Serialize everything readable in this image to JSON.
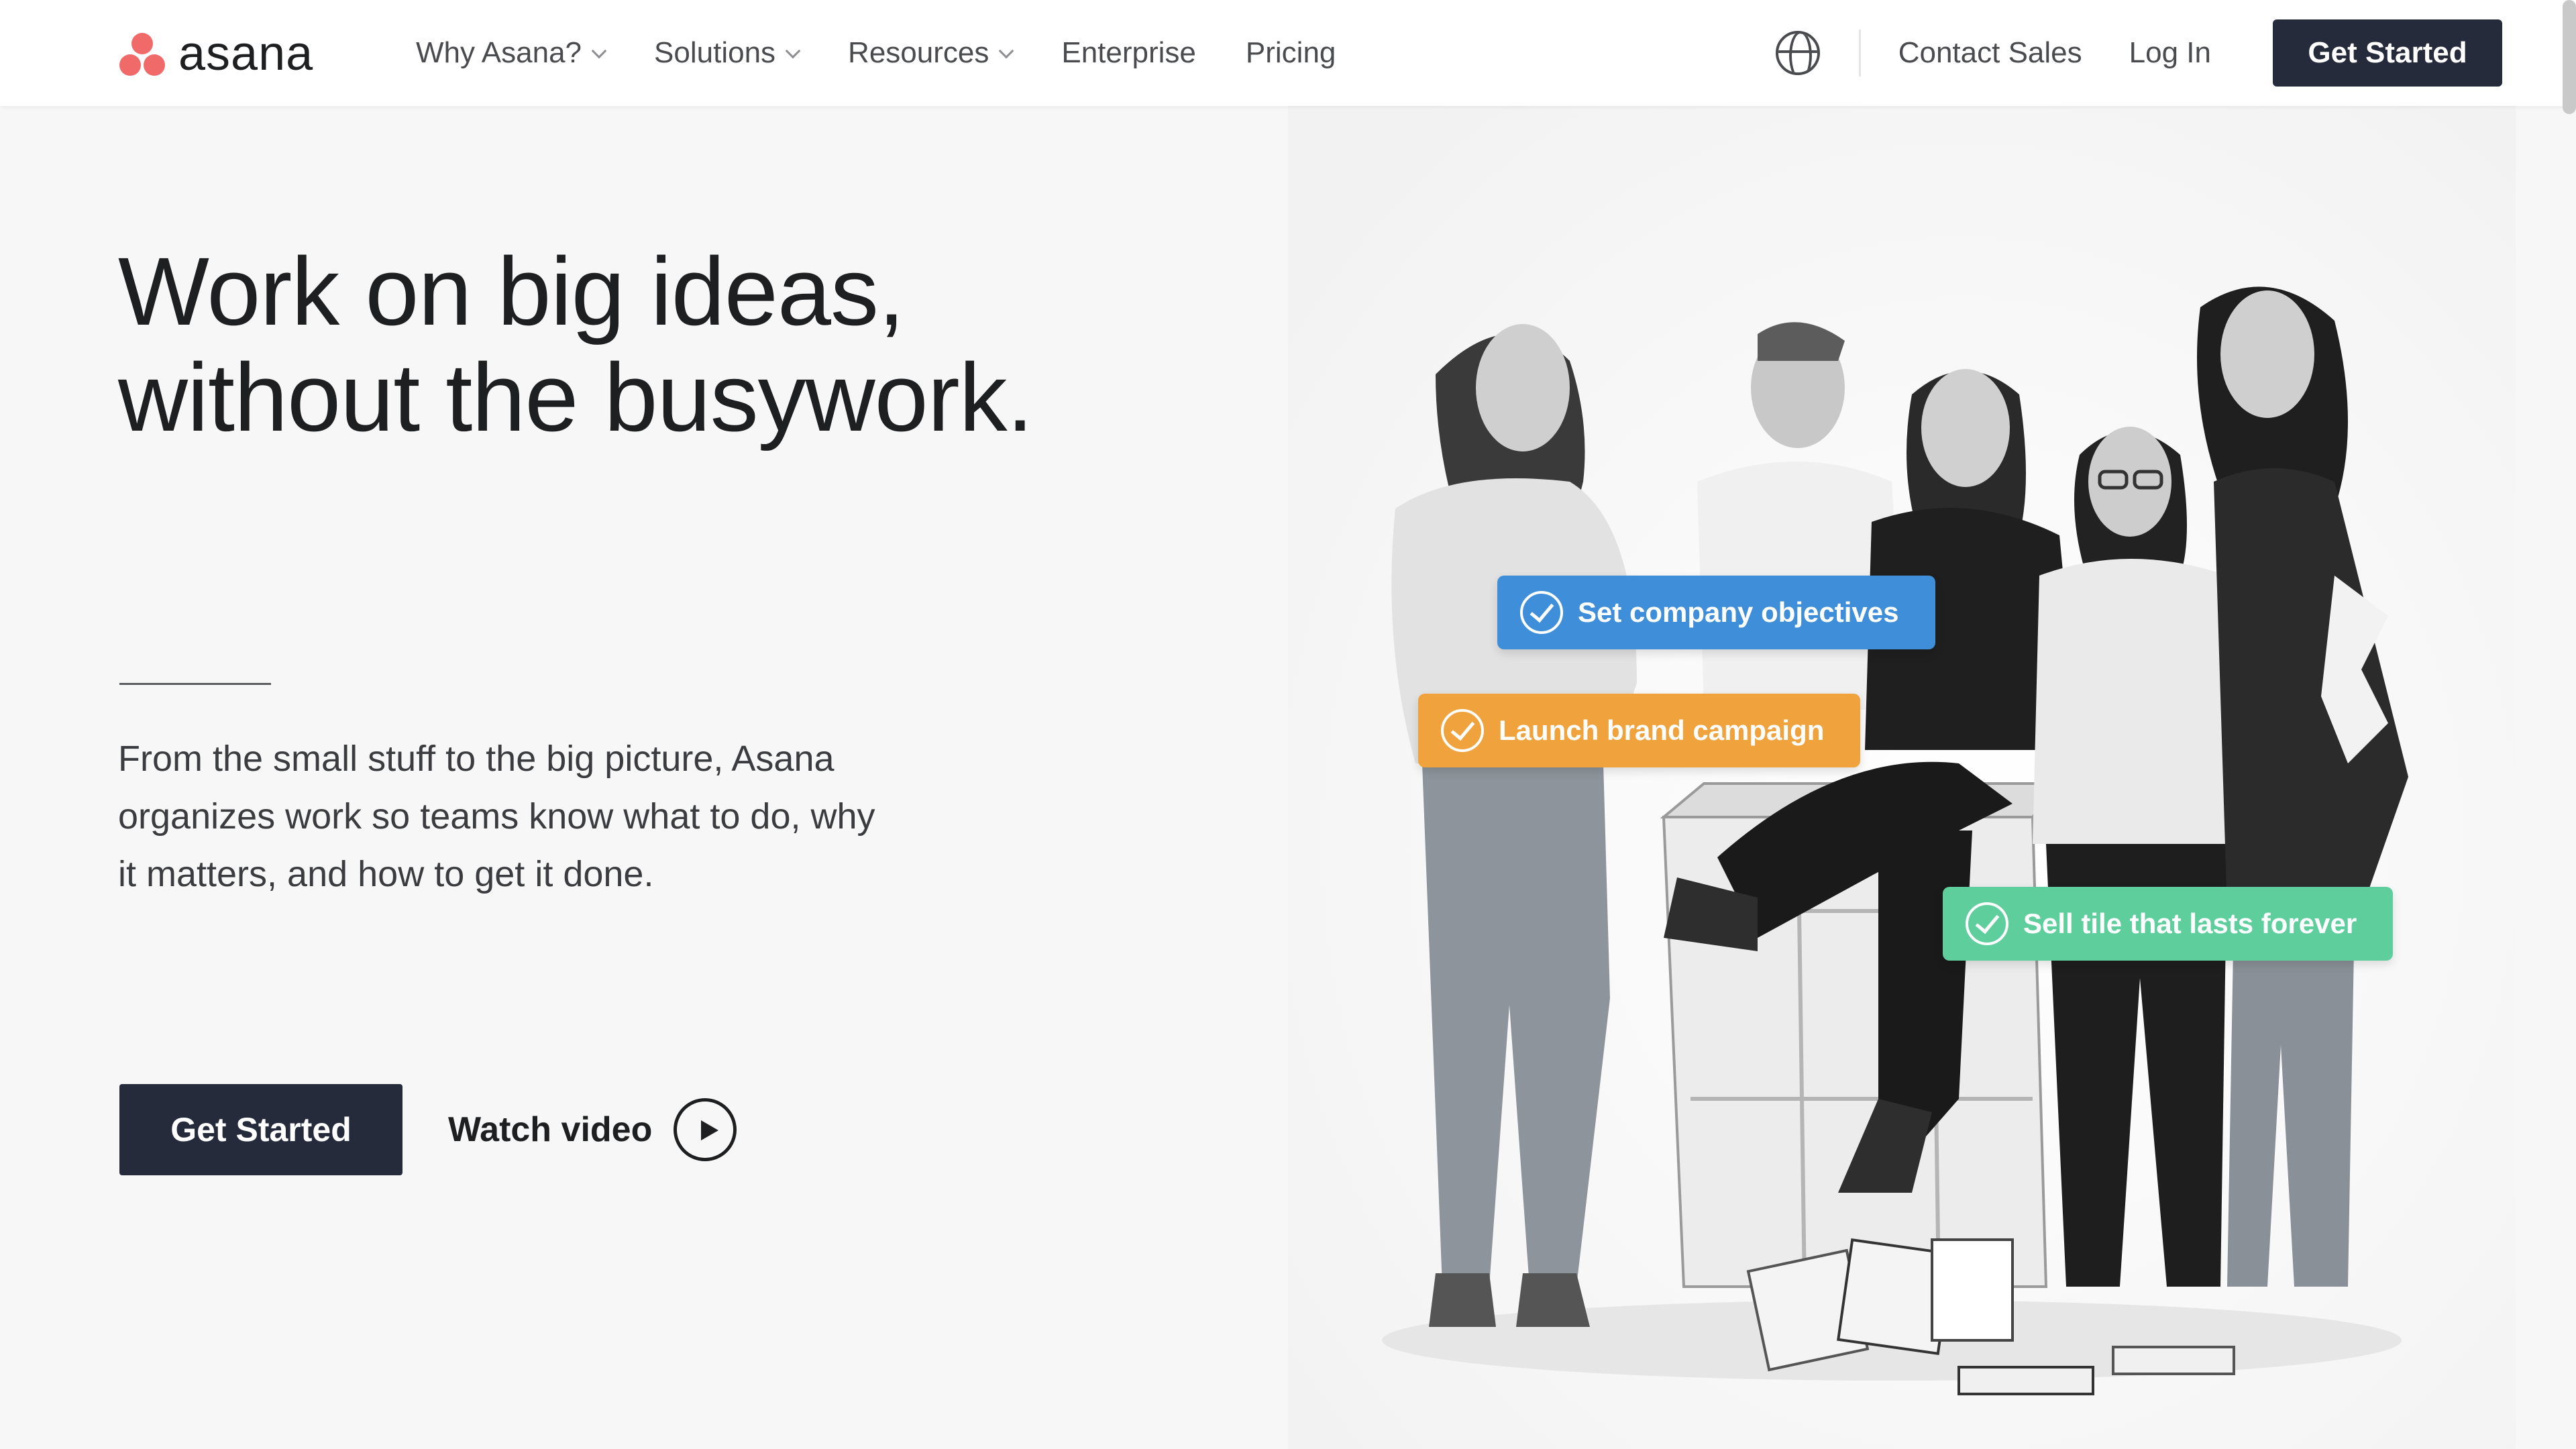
{
  "colors": {
    "brand": "#f06a6a",
    "dark_button": "#252b3b",
    "chip_blue": "#3f8ed9",
    "chip_orange": "#f0a33c",
    "chip_green": "#5ecf9c"
  },
  "nav": {
    "logo_text": "asana",
    "links": [
      {
        "label": "Why Asana?",
        "has_dropdown": true
      },
      {
        "label": "Solutions",
        "has_dropdown": true
      },
      {
        "label": "Resources",
        "has_dropdown": true
      },
      {
        "label": "Enterprise",
        "has_dropdown": false
      },
      {
        "label": "Pricing",
        "has_dropdown": false
      }
    ],
    "globe_icon": "globe-icon",
    "contact_sales": "Contact Sales",
    "log_in": "Log In",
    "cta": "Get Started"
  },
  "hero": {
    "headline_line1": "Work on big ideas,",
    "headline_line2": "without the busywork.",
    "subtext": "From the small stuff to the big picture, Asana organizes work so teams know what to do, why it matters, and how to get it done.",
    "cta": "Get Started",
    "watch_video": "Watch video"
  },
  "chips": [
    {
      "label": "Set company objectives",
      "color": "blue"
    },
    {
      "label": "Launch brand campaign",
      "color": "orange"
    },
    {
      "label": "Sell tile that lasts forever",
      "color": "green"
    }
  ]
}
